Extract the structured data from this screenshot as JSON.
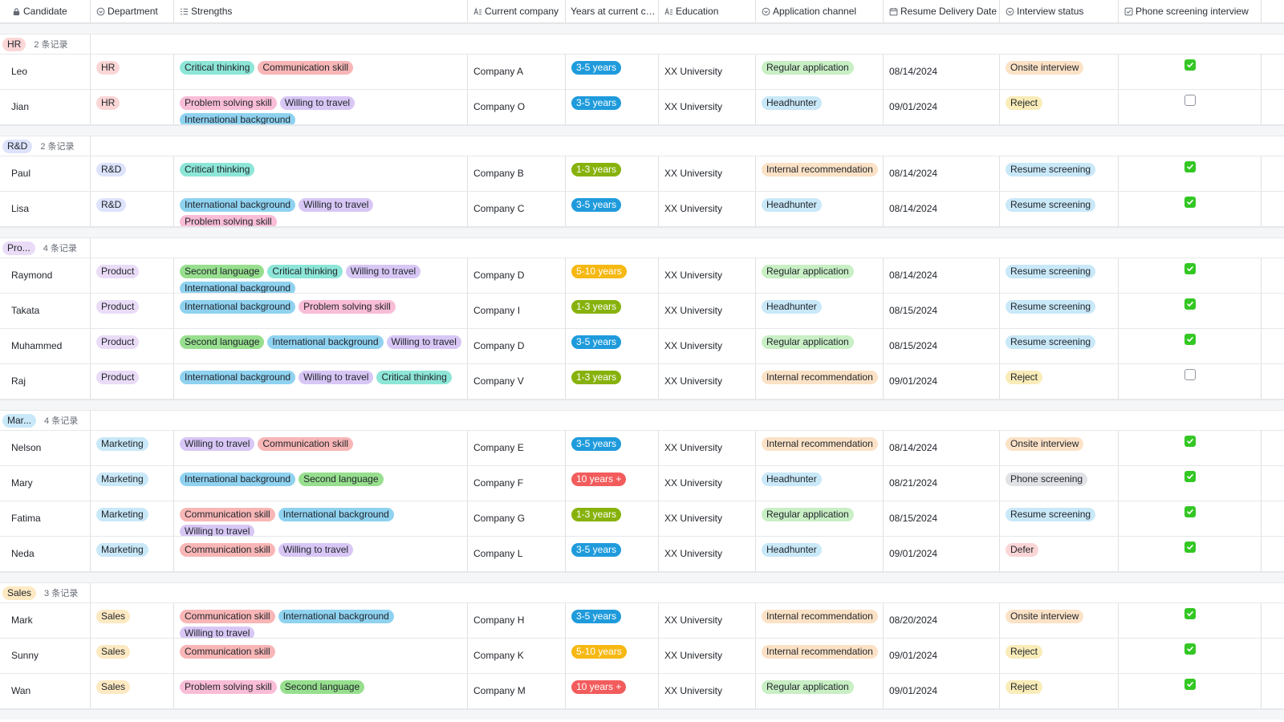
{
  "columns": [
    {
      "key": "candidate",
      "label": "Candidate",
      "icon": "text-lock"
    },
    {
      "key": "department",
      "label": "Department",
      "icon": "single-select"
    },
    {
      "key": "strengths",
      "label": "Strengths",
      "icon": "multi-select"
    },
    {
      "key": "company",
      "label": "Current company",
      "icon": "text"
    },
    {
      "key": "years",
      "label": "Years at current co...",
      "icon": "none"
    },
    {
      "key": "education",
      "label": "Education",
      "icon": "text"
    },
    {
      "key": "channel",
      "label": "Application channel",
      "icon": "single-select"
    },
    {
      "key": "date",
      "label": "Resume Delivery Date",
      "icon": "calendar"
    },
    {
      "key": "status",
      "label": "Interview status",
      "icon": "single-select"
    },
    {
      "key": "phone",
      "label": "Phone screening interview",
      "icon": "checkbox"
    }
  ],
  "tag_colors": {
    "Critical thinking": "#8de6d7",
    "Communication skill": "#f8b6b6",
    "Problem solving skill": "#f9bdd7",
    "Willing to travel": "#d8c7f5",
    "International background": "#8fd2f0",
    "Second language": "#97df8e"
  },
  "years_colors": {
    "3-5 years": {
      "bg": "#1f9bdc",
      "fg": "#ffffff"
    },
    "1-3 years": {
      "bg": "#87b20c",
      "fg": "#ffffff"
    },
    "5-10 years": {
      "bg": "#f6b812",
      "fg": "#ffffff"
    },
    "10 years +": {
      "bg": "#f25c5c",
      "fg": "#ffffff"
    }
  },
  "channel_colors": {
    "Regular application": "#c9efc5",
    "Headhunter": "#c9e8f8",
    "Internal recommendation": "#fbe2c6"
  },
  "status_colors": {
    "Onsite interview": "#fbe2c6",
    "Reject": "#f9ecb8",
    "Resume screening": "#c9e8f8",
    "Phone screening": "#e0e2e6",
    "Defer": "#fbd6d6"
  },
  "dept_colors": {
    "HR": "#fbd6d6",
    "R&D": "#dde3fb",
    "Product": "#eadcf7",
    "Marketing": "#c9e8f8",
    "Sales": "#fde9c2"
  },
  "groups": [
    {
      "label": "HR",
      "count": "2 条记录",
      "rows": [
        {
          "name": "Leo",
          "dept": "HR",
          "strengths": [
            "Critical thinking",
            "Communication skill"
          ],
          "company": "Company A",
          "years": "3-5 years",
          "education": "XX University",
          "channel": "Regular application",
          "date": "08/14/2024",
          "status": "Onsite interview",
          "phone": true
        },
        {
          "name": "Jian",
          "dept": "HR",
          "strengths": [
            "Problem solving skill",
            "Willing to travel",
            "International background"
          ],
          "company": "Company O",
          "years": "3-5 years",
          "education": "XX University",
          "channel": "Headhunter",
          "date": "09/01/2024",
          "status": "Reject",
          "phone": false
        }
      ]
    },
    {
      "label": "R&D",
      "count": "2 条记录",
      "rows": [
        {
          "name": "Paul",
          "dept": "R&D",
          "strengths": [
            "Critical thinking"
          ],
          "company": "Company B",
          "years": "1-3 years",
          "education": "XX University",
          "channel": "Internal recommendation",
          "date": "08/14/2024",
          "status": "Resume screening",
          "phone": true
        },
        {
          "name": "Lisa",
          "dept": "R&D",
          "strengths": [
            "International background",
            "Willing to travel",
            "Problem solving skill"
          ],
          "company": "Company C",
          "years": "3-5 years",
          "education": "XX University",
          "channel": "Headhunter",
          "date": "08/14/2024",
          "status": "Resume screening",
          "phone": true
        }
      ]
    },
    {
      "label": "Pro...",
      "dept_color_key": "Product",
      "count": "4 条记录",
      "rows": [
        {
          "name": "Raymond",
          "dept": "Product",
          "strengths": [
            "Second language",
            "Critical thinking",
            "Willing to travel",
            "International background"
          ],
          "company": "Company D",
          "years": "5-10 years",
          "education": "XX University",
          "channel": "Regular application",
          "date": "08/14/2024",
          "status": "Resume screening",
          "phone": true
        },
        {
          "name": "Takata",
          "dept": "Product",
          "strengths": [
            "International background",
            "Problem solving skill"
          ],
          "company": "Company I",
          "years": "1-3 years",
          "education": "XX University",
          "channel": "Headhunter",
          "date": "08/15/2024",
          "status": "Resume screening",
          "phone": true
        },
        {
          "name": "Muhammed",
          "dept": "Product",
          "strengths": [
            "Second language",
            "International background",
            "Willing to travel"
          ],
          "company": "Company D",
          "years": "3-5 years",
          "education": "XX University",
          "channel": "Regular application",
          "date": "08/15/2024",
          "status": "Resume screening",
          "phone": true
        },
        {
          "name": "Raj",
          "dept": "Product",
          "strengths": [
            "International background",
            "Willing to travel",
            "Critical thinking"
          ],
          "company": "Company V",
          "years": "1-3 years",
          "education": "XX University",
          "channel": "Internal recommendation",
          "date": "09/01/2024",
          "status": "Reject",
          "phone": false
        }
      ]
    },
    {
      "label": "Mar...",
      "dept_color_key": "Marketing",
      "count": "4 条记录",
      "rows": [
        {
          "name": "Nelson",
          "dept": "Marketing",
          "strengths": [
            "Willing to travel",
            "Communication skill"
          ],
          "company": "Company E",
          "years": "3-5 years",
          "education": "XX University",
          "channel": "Internal recommendation",
          "date": "08/14/2024",
          "status": "Onsite interview",
          "phone": true
        },
        {
          "name": "Mary",
          "dept": "Marketing",
          "strengths": [
            "International background",
            "Second language"
          ],
          "company": "Company F",
          "years": "10 years +",
          "education": "XX University",
          "channel": "Headhunter",
          "date": "08/21/2024",
          "status": "Phone screening",
          "phone": true
        },
        {
          "name": "Fatima",
          "dept": "Marketing",
          "strengths": [
            "Communication skill",
            "International background",
            "Willing to travel"
          ],
          "company": "Company G",
          "years": "1-3 years",
          "education": "XX University",
          "channel": "Regular application",
          "date": "08/15/2024",
          "status": "Resume screening",
          "phone": true
        },
        {
          "name": "Neda",
          "dept": "Marketing",
          "strengths": [
            "Communication skill",
            "Willing to travel"
          ],
          "company": "Company L",
          "years": "3-5 years",
          "education": "XX University",
          "channel": "Headhunter",
          "date": "09/01/2024",
          "status": "Defer",
          "phone": true
        }
      ]
    },
    {
      "label": "Sales",
      "count": "3 条记录",
      "rows": [
        {
          "name": "Mark",
          "dept": "Sales",
          "strengths": [
            "Communication skill",
            "International background",
            "Willing to travel"
          ],
          "company": "Company H",
          "years": "3-5 years",
          "education": "XX University",
          "channel": "Internal recommendation",
          "date": "08/20/2024",
          "status": "Onsite interview",
          "phone": true
        },
        {
          "name": "Sunny",
          "dept": "Sales",
          "strengths": [
            "Communication skill"
          ],
          "company": "Company K",
          "years": "5-10 years",
          "education": "XX University",
          "channel": "Internal recommendation",
          "date": "09/01/2024",
          "status": "Reject",
          "phone": true
        },
        {
          "name": "Wan",
          "dept": "Sales",
          "strengths": [
            "Problem solving skill",
            "Second language"
          ],
          "company": "Company M",
          "years": "10 years +",
          "education": "XX University",
          "channel": "Regular application",
          "date": "09/01/2024",
          "status": "Reject",
          "phone": true
        }
      ]
    }
  ]
}
